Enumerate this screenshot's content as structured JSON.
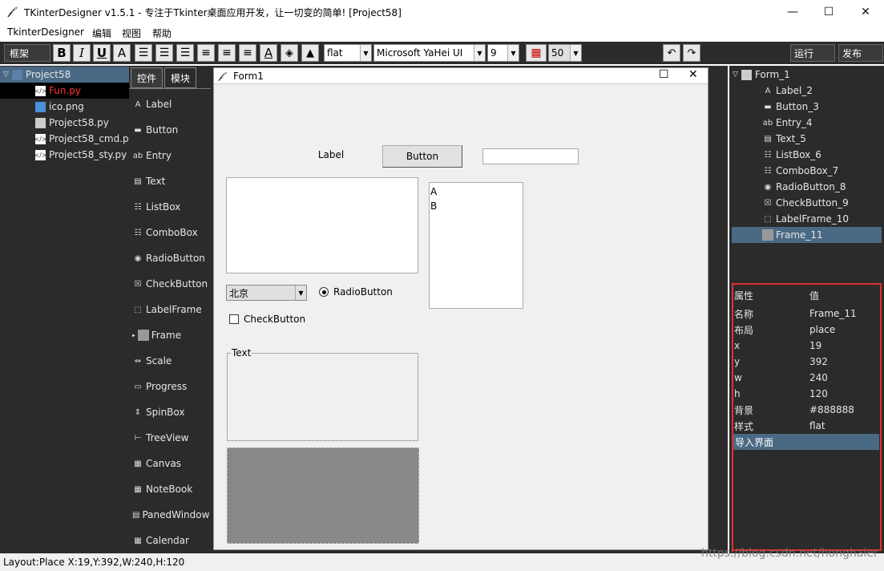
{
  "window": {
    "title": "TKinterDesigner v1.5.1 - 专注于Tkinter桌面应用开发，让一切变的简单!   [Project58]",
    "minimize": "—",
    "maximize": "☐",
    "close": "✕"
  },
  "menu": [
    "TkinterDesigner",
    "编辑",
    "视图",
    "帮助"
  ],
  "toolbar": {
    "frame_combo": "框架",
    "bold": "B",
    "italic": "I",
    "underline": "U",
    "font_a": "A",
    "relief_value": "flat",
    "font_family": "Microsoft YaHei UI",
    "font_size": "9",
    "grid_size": "50",
    "run": "运行",
    "publish": "发布"
  },
  "project": {
    "root": "Project58",
    "files": [
      {
        "name": "Fun.py",
        "active": true
      },
      {
        "name": "ico.png",
        "active": false
      },
      {
        "name": "Project58.py",
        "active": false
      },
      {
        "name": "Project58_cmd.py",
        "active": false
      },
      {
        "name": "Project58_sty.py",
        "active": false
      }
    ]
  },
  "toolbox": {
    "tabs": [
      "控件",
      "模块"
    ],
    "items": [
      "Label",
      "Button",
      "Entry",
      "Text",
      "ListBox",
      "ComboBox",
      "RadioButton",
      "CheckButton",
      "LabelFrame",
      "Frame",
      "Scale",
      "Progress",
      "SpinBox",
      "TreeView",
      "Canvas",
      "NoteBook",
      "PanedWindow",
      "Calendar"
    ]
  },
  "form": {
    "title": "Form1",
    "maximize": "☐",
    "close": "✕",
    "label_text": "Label",
    "button_text": "Button",
    "listbox_items": [
      "A",
      "B"
    ],
    "combo_value": "北京",
    "radio_text": "RadioButton",
    "check_text": "CheckButton",
    "labelframe_text": "Text"
  },
  "tree": {
    "root": "Form_1",
    "items": [
      {
        "name": "Label_2",
        "selected": false
      },
      {
        "name": "Button_3",
        "selected": false
      },
      {
        "name": "Entry_4",
        "selected": false
      },
      {
        "name": "Text_5",
        "selected": false
      },
      {
        "name": "ListBox_6",
        "selected": false
      },
      {
        "name": "ComboBox_7",
        "selected": false
      },
      {
        "name": "RadioButton_8",
        "selected": false
      },
      {
        "name": "CheckButton_9",
        "selected": false
      },
      {
        "name": "LabelFrame_10",
        "selected": false
      },
      {
        "name": "Frame_11",
        "selected": true
      }
    ]
  },
  "properties": {
    "header": {
      "key": "属性",
      "value": "值"
    },
    "rows": [
      {
        "key": "名称",
        "value": "Frame_11"
      },
      {
        "key": "布局",
        "value": "place"
      },
      {
        "key": "x",
        "value": "19"
      },
      {
        "key": "y",
        "value": "392"
      },
      {
        "key": "w",
        "value": "240"
      },
      {
        "key": "h",
        "value": "120"
      },
      {
        "key": "背景",
        "value": "#888888"
      },
      {
        "key": "样式",
        "value": "flat"
      }
    ],
    "import_row": "导入界面"
  },
  "status": {
    "text": "Layout:Place  X:19,Y:392,W:240,H:120",
    "watermark": "https://blog.csdn.net/honghaier"
  },
  "colors": {
    "panel_bg": "#2b2b2b",
    "selection": "#4a6984",
    "active_file": "#ff3333",
    "highlight_border": "#e03030",
    "frame_bg": "#888888"
  }
}
